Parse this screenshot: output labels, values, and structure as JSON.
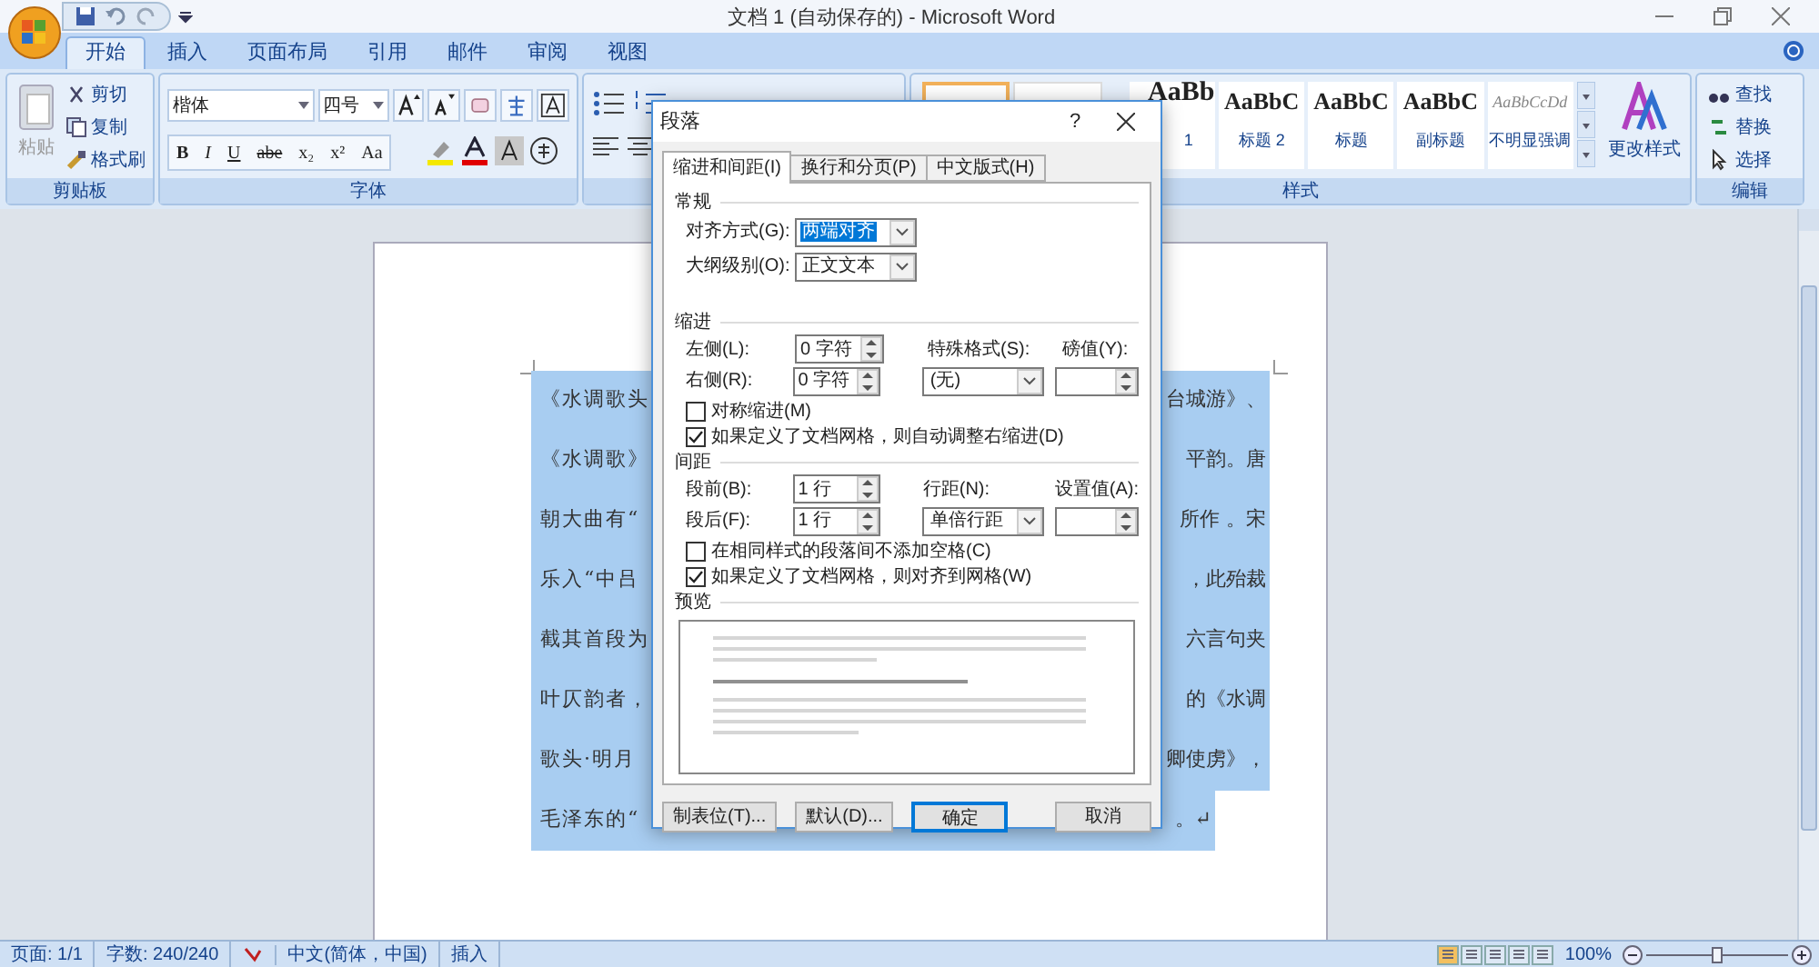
{
  "window": {
    "title": "文档 1 (自动保存的) - Microsoft Word"
  },
  "tabs": [
    {
      "label": "开始",
      "selected": true
    },
    {
      "label": "插入",
      "selected": false
    },
    {
      "label": "页面布局",
      "selected": false
    },
    {
      "label": "引用",
      "selected": false
    },
    {
      "label": "邮件",
      "selected": false
    },
    {
      "label": "审阅",
      "selected": false
    },
    {
      "label": "视图",
      "selected": false
    }
  ],
  "ribbon": {
    "clipboard": {
      "paste": "粘贴",
      "items": [
        "剪切",
        "复制",
        "格式刷"
      ],
      "group": "剪贴板"
    },
    "font": {
      "font_name": "楷体",
      "font_size": "四号",
      "format_buttons": [
        "B",
        "I",
        "U",
        "abe",
        "x₂",
        "x²",
        "Aa"
      ],
      "group": "字体"
    },
    "styles": {
      "items": [
        {
          "preview": "AaBb",
          "label": "1",
          "kind": "heading1"
        },
        {
          "preview": "AaBbC",
          "label": "标题 2",
          "kind": "heading"
        },
        {
          "preview": "AaBbC",
          "label": "标题",
          "kind": "heading"
        },
        {
          "preview": "AaBbC",
          "label": "副标题",
          "kind": "heading"
        },
        {
          "preview": "AaBbCcDd",
          "label": "不明显强调",
          "kind": "subtle"
        }
      ],
      "change_styles": "更改样式",
      "group": "样式"
    },
    "editing": {
      "items": [
        "查找",
        "替换",
        "选择"
      ],
      "group": "编辑"
    }
  },
  "document": {
    "selected": true,
    "lines": [
      {
        "left": "《水调歌头",
        "right": "台城游》、"
      },
      {
        "left": "《水调歌》",
        "right": "平韵。唐"
      },
      {
        "left": "朝大曲有“",
        "right": "所作 。宋"
      },
      {
        "left": "乐入“中吕",
        "right": "，此殆裁"
      },
      {
        "left": "截其首段为",
        "right": "六言句夹"
      },
      {
        "left": "叶仄韵者，",
        "right": "的《水调"
      },
      {
        "left": "歌头·明月",
        "right": "卿使虏》，"
      },
      {
        "left": "毛泽东的“",
        "right": "。↵"
      }
    ]
  },
  "dialog": {
    "title": "段落",
    "help": "?",
    "tabs": [
      {
        "label": "缩进和间距(I)",
        "selected": true
      },
      {
        "label": "换行和分页(P)",
        "selected": false
      },
      {
        "label": "中文版式(H)",
        "selected": false
      }
    ],
    "general": {
      "heading": "常规",
      "alignment": {
        "label": "对齐方式(G):",
        "value": "两端对齐",
        "selected": true
      },
      "outline": {
        "label": "大纲级别(O):",
        "value": "正文文本"
      }
    },
    "indent": {
      "heading": "缩进",
      "left": {
        "label": "左侧(L):",
        "value": "0 字符"
      },
      "right": {
        "label": "右侧(R):",
        "value": "0 字符"
      },
      "special": {
        "label": "特殊格式(S):",
        "value": "(无)"
      },
      "by": {
        "label": "磅值(Y):"
      },
      "mirror": {
        "label": "对称缩进(M)",
        "checked": false
      },
      "auto_adjust": {
        "label": "如果定义了文档网格，则自动调整右缩进(D)",
        "checked": true
      }
    },
    "spacing": {
      "heading": "间距",
      "before": {
        "label": "段前(B):",
        "value": "1 行"
      },
      "after": {
        "label": "段后(F):",
        "value": "1 行"
      },
      "line_spacing": {
        "label": "行距(N):",
        "value": "单倍行距"
      },
      "at": {
        "label": "设置值(A):"
      },
      "no_space": {
        "label": "在相同样式的段落间不添加空格(C)",
        "checked": false
      },
      "snap": {
        "label": "如果定义了文档网格，则对齐到网格(W)",
        "checked": true
      }
    },
    "preview": {
      "heading": "预览"
    },
    "buttons": [
      {
        "label": "制表位(T)...",
        "kind": "normal"
      },
      {
        "label": "默认(D)...",
        "kind": "normal"
      },
      {
        "label": "确定",
        "kind": "default"
      },
      {
        "label": "取消",
        "kind": "normal"
      }
    ]
  },
  "status_bar": {
    "page": "页面: 1/1",
    "words": "字数: 240/240",
    "language": "中文(简体，中国)",
    "mode": "插入",
    "zoom": "100%",
    "zoom_slider": {
      "level": 0.5
    }
  }
}
